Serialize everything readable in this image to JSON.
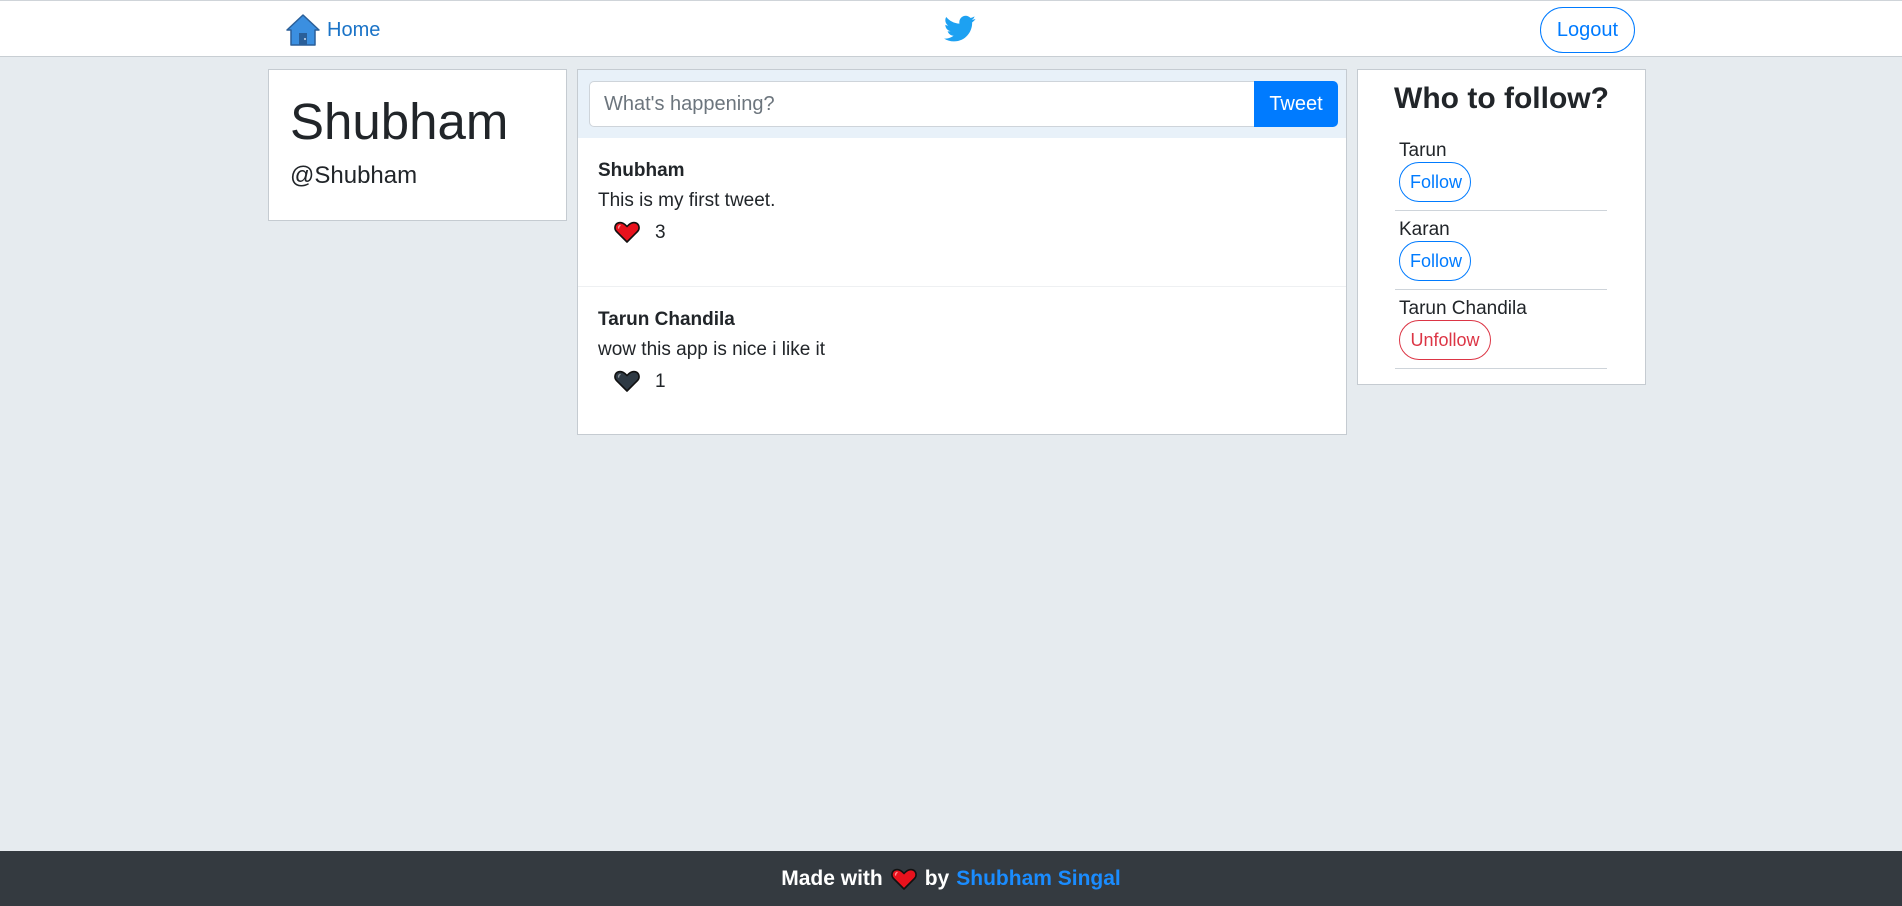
{
  "navbar": {
    "home_label": "Home",
    "home_icon": "house-icon",
    "brand_icon": "twitter-bird-icon",
    "logout_label": "Logout"
  },
  "profile": {
    "name": "Shubham",
    "handle": "@Shubham"
  },
  "compose": {
    "placeholder": "What's happening?",
    "value": "",
    "tweet_label": "Tweet"
  },
  "tweets": [
    {
      "author": "Shubham",
      "text": "This is my first tweet.",
      "likes": "3",
      "liked": true
    },
    {
      "author": "Tarun Chandila",
      "text": "wow this app is nice i like it",
      "likes": "1",
      "liked": false
    }
  ],
  "who_to_follow": {
    "title": "Who to follow?",
    "users": [
      {
        "name": "Tarun",
        "action": "Follow"
      },
      {
        "name": "Karan",
        "action": "Follow"
      },
      {
        "name": "Tarun Chandila",
        "action": "Unfollow"
      }
    ]
  },
  "footer": {
    "made_with": "Made with",
    "by": "by",
    "author_link": "Shubham Singal"
  },
  "colors": {
    "primary": "#007bff",
    "danger": "#dc3545",
    "heart_red": "#e8121d",
    "heart_dark": "#2f3a44",
    "page_bg": "#e6ebef",
    "footer_bg": "#343a40"
  }
}
